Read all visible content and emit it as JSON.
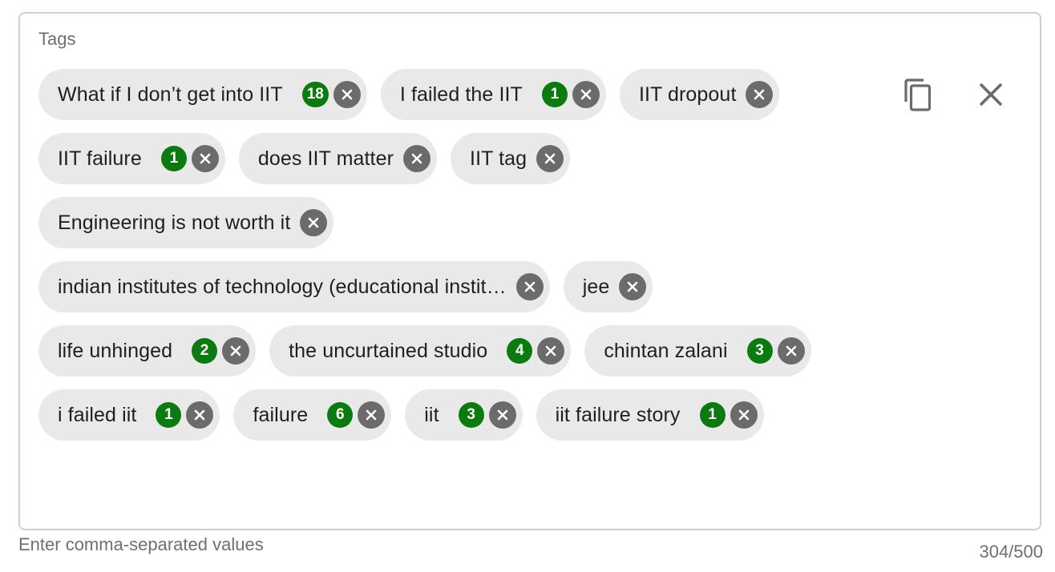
{
  "field": {
    "label": "Tags",
    "hint": "Enter comma-separated values",
    "counter": "304/500"
  },
  "colors": {
    "chip_bg": "#e9e9e9",
    "badge_bg": "#0b7a0f",
    "remove_bg": "#6b6b6b",
    "border": "#cfcfcf"
  },
  "actions": {
    "copy_icon": "copy-icon",
    "clear_icon": "close-icon"
  },
  "tags": [
    {
      "text": "What if I don’t get into IIT",
      "count": "18"
    },
    {
      "text": "I failed the IIT",
      "count": "1"
    },
    {
      "text": "IIT dropout",
      "count": null
    },
    {
      "text": "IIT failure",
      "count": "1"
    },
    {
      "text": "does IIT matter",
      "count": null
    },
    {
      "text": "IIT tag",
      "count": null
    },
    {
      "text": "Engineering is not worth it",
      "count": null
    },
    {
      "text": "indian institutes of technology (educational instit…",
      "count": null
    },
    {
      "text": "jee",
      "count": null
    },
    {
      "text": "life unhinged",
      "count": "2"
    },
    {
      "text": "the uncurtained studio",
      "count": "4"
    },
    {
      "text": "chintan zalani",
      "count": "3"
    },
    {
      "text": "i failed iit",
      "count": "1"
    },
    {
      "text": "failure",
      "count": "6"
    },
    {
      "text": "iit",
      "count": "3"
    },
    {
      "text": "iit failure story",
      "count": "1"
    }
  ]
}
